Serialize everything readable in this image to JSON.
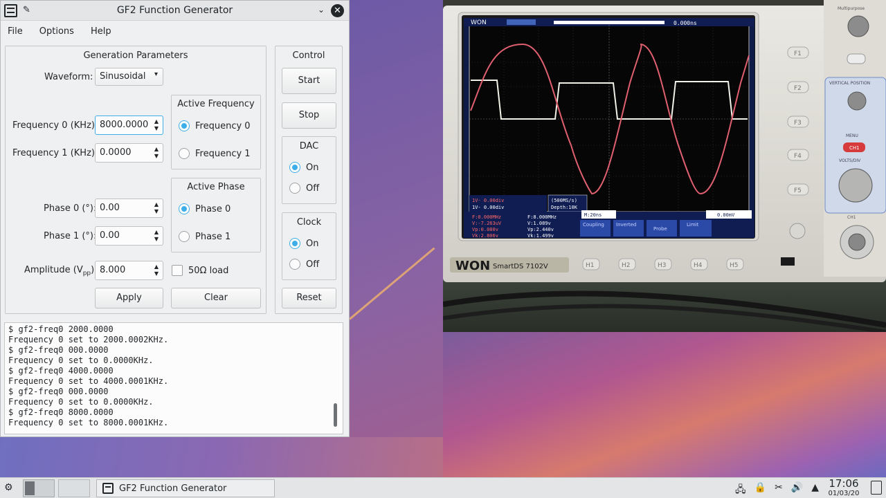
{
  "window": {
    "title": "GF2 Function Generator",
    "menu": [
      "File",
      "Options",
      "Help"
    ]
  },
  "generation": {
    "title": "Generation Parameters",
    "waveform_label": "Waveform:",
    "waveform_value": "Sinusoidal",
    "freq0_label": "Frequency 0 (KHz):",
    "freq0_value": "8000.0000",
    "freq1_label": "Frequency 1 (KHz):",
    "freq1_value": "0.0000",
    "phase0_label": "Phase 0 (°):",
    "phase0_value": "0.00",
    "phase1_label": "Phase 1 (°):",
    "phase1_value": "0.00",
    "amplitude_label": "Amplitude (V",
    "amplitude_sub": "pp",
    "amplitude_suffix": "):",
    "amplitude_value": "8.000",
    "load_label": "50Ω load",
    "apply": "Apply",
    "clear": "Clear"
  },
  "active_frequency": {
    "title": "Active Frequency",
    "opt0": "Frequency 0",
    "opt1": "Frequency 1",
    "selected": 0
  },
  "active_phase": {
    "title": "Active Phase",
    "opt0": "Phase 0",
    "opt1": "Phase 1",
    "selected": 0
  },
  "control": {
    "title": "Control",
    "start": "Start",
    "stop": "Stop",
    "dac": {
      "title": "DAC",
      "on": "On",
      "off": "Off",
      "selected": "On"
    },
    "clock": {
      "title": "Clock",
      "on": "On",
      "off": "Off",
      "selected": "On"
    },
    "reset": "Reset"
  },
  "console": {
    "lines": [
      "$ gf2-freq0 2000.0000",
      "Frequency 0 set to 2000.0002KHz.",
      "$ gf2-freq0 000.0000",
      "Frequency 0 set to 0.0000KHz.",
      "$ gf2-freq0 4000.0000",
      "Frequency 0 set to 4000.0001KHz.",
      "$ gf2-freq0 000.0000",
      "Frequency 0 set to 0.0000KHz.",
      "$ gf2-freq0 8000.0000",
      "Frequency 0 set to 8000.0001KHz."
    ]
  },
  "scope": {
    "brand": "WON",
    "model": "SmartDS 7102V",
    "timebase": "0.000ns",
    "ch1_scale": "1V-    0.00div",
    "ch2_scale": "1V-    0.00div",
    "sample": "(500MS/s)",
    "depth": "Depth:10K",
    "time_div": "M:20ns",
    "trigger": "0.00mV",
    "meas_left": [
      "F:0.000MHz",
      "V:-7.263uV",
      "Vp:0.080v",
      "Vk:2.806v"
    ],
    "meas_right": [
      "F:8.000MHz",
      "V:1.089v",
      "Vp:2.440v",
      "Vk:1.499v"
    ],
    "softkeys": [
      "Coupling",
      "Inverted",
      "Probe",
      "Limit"
    ],
    "side_buttons": [
      "F1",
      "F2",
      "F3",
      "F4",
      "F5"
    ],
    "bottom_buttons": [
      "H1",
      "H2",
      "H3",
      "H4",
      "H5"
    ],
    "panel_labels": [
      "Multipurpose",
      "VERTICAL POSITION",
      "MENU",
      "CH1",
      "VOLTS/DIV",
      "CH1"
    ]
  },
  "taskbar": {
    "task_label": "GF2 Function Generator",
    "time": "17:06",
    "date": "01/03/20"
  }
}
